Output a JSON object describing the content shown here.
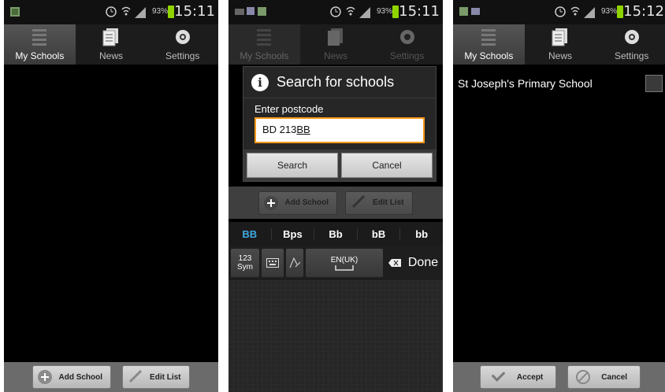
{
  "screens": [
    {
      "status": {
        "time": "15:11",
        "battery": "93%"
      },
      "tabs": [
        {
          "label": "My Schools"
        },
        {
          "label": "News"
        },
        {
          "label": "Settings"
        }
      ],
      "bottom": {
        "add": "Add School",
        "edit": "Edit List"
      }
    },
    {
      "status": {
        "time": "15:11",
        "battery": "93%"
      },
      "tabs": [
        {
          "label": "My Schools"
        },
        {
          "label": "News"
        },
        {
          "label": "Settings"
        }
      ],
      "dialog": {
        "title": "Search for schools",
        "label": "Enter postcode",
        "value_plain": "BD 213",
        "value_underlined": "BB",
        "search": "Search",
        "cancel": "Cancel"
      },
      "bottom": {
        "add": "Add School",
        "edit": "Edit List"
      },
      "suggestions": [
        "BB",
        "Bps",
        "Bb",
        "bB",
        "bb"
      ],
      "keys": {
        "sym_top": "123",
        "sym_bottom": "Sym",
        "space": "EN(UK)",
        "done": "Done"
      }
    },
    {
      "status": {
        "time": "15:12",
        "battery": "93%"
      },
      "tabs": [
        {
          "label": "My Schools"
        },
        {
          "label": "News"
        },
        {
          "label": "Settings"
        }
      ],
      "school": "St Joseph's Primary School",
      "bottom": {
        "accept": "Accept",
        "cancel": "Cancel"
      }
    }
  ]
}
